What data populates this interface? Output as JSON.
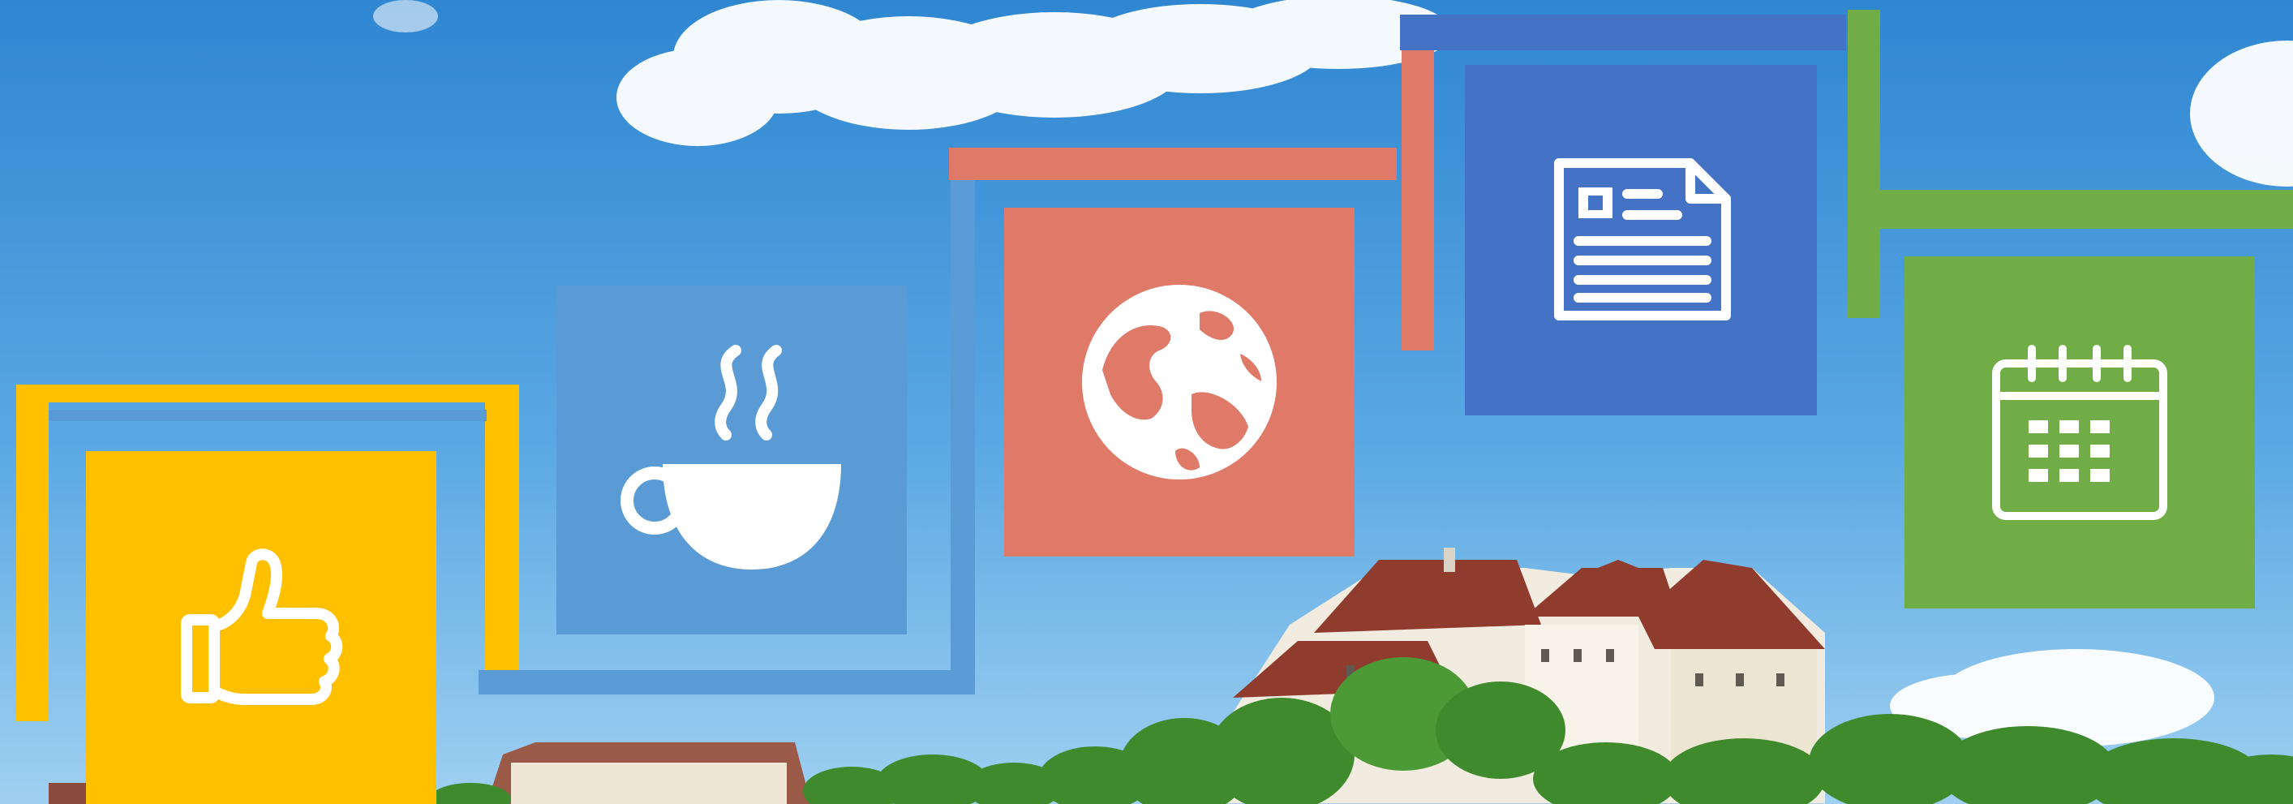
{
  "banner": {
    "colors": {
      "sky_top": "#2f86d1",
      "sky_bottom": "#8cc6ee",
      "yellow": "#ffc000",
      "light_blue": "#5b9bd5",
      "salmon": "#e07a68",
      "dark_blue": "#4472c4",
      "green": "#70ad47",
      "icon": "#ffffff",
      "castle_wall": "#f1ecdf",
      "castle_roof": "#8f3b2e",
      "trees": "#3f8a2c"
    },
    "tiles": [
      {
        "id": "like",
        "icon": "thumbs-up-icon",
        "color": "yellow"
      },
      {
        "id": "coffee",
        "icon": "coffee-cup-icon",
        "color": "light_blue"
      },
      {
        "id": "globe",
        "icon": "globe-icon",
        "color": "salmon"
      },
      {
        "id": "news",
        "icon": "newspaper-icon",
        "color": "dark_blue"
      },
      {
        "id": "calendar",
        "icon": "calendar-icon",
        "color": "green"
      }
    ]
  }
}
